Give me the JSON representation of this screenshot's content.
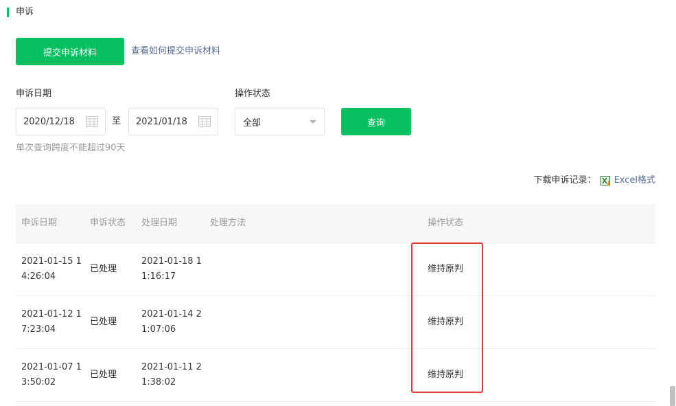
{
  "section": {
    "title": "申诉"
  },
  "actions": {
    "submit_label": "提交申诉材料",
    "help_link": "查看如何提交申诉材料"
  },
  "filters": {
    "date_label": "申诉日期",
    "start_date": "2020/12/18",
    "to_text": "至",
    "end_date": "2021/01/18",
    "status_label": "操作状态",
    "status_selected": "全部",
    "query_label": "查询",
    "hint": "单次查询跨度不能超过90天"
  },
  "download": {
    "prefix": "下载申诉记录：",
    "excel_link": "Excel格式"
  },
  "table": {
    "headers": [
      "申诉日期",
      "申诉状态",
      "处理日期",
      "处理方法",
      "操作状态"
    ],
    "rows": [
      {
        "appeal_date": "2021-01-15 14:26:04",
        "status": "已处理",
        "handle_date": "2021-01-18 11:16:17",
        "method": "",
        "op_status": "维持原判"
      },
      {
        "appeal_date": "2021-01-12 17:23:04",
        "status": "已处理",
        "handle_date": "2021-01-14 21:07:06",
        "method": "",
        "op_status": "维持原判"
      },
      {
        "appeal_date": "2021-01-07 13:50:02",
        "status": "已处理",
        "handle_date": "2021-01-11 21:38:02",
        "method": "",
        "op_status": "维持原判"
      }
    ]
  },
  "colors": {
    "brand_green": "#07c160",
    "link_blue": "#576b95",
    "highlight_red": "#e53935"
  }
}
